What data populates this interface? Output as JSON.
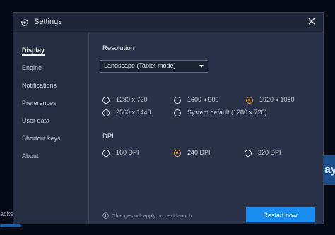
{
  "window": {
    "title": "Settings",
    "icons": {
      "app": "gear-icon",
      "close": "close-icon"
    }
  },
  "sidebar": {
    "items": [
      {
        "label": "Display",
        "active": true
      },
      {
        "label": "Engine"
      },
      {
        "label": "Notifications"
      },
      {
        "label": "Preferences"
      },
      {
        "label": "User data"
      },
      {
        "label": "Shortcut keys"
      },
      {
        "label": "About"
      }
    ]
  },
  "display": {
    "resolution": {
      "heading": "Resolution",
      "mode_selected": "Landscape (Tablet mode)",
      "options": [
        {
          "label": "1280 x 720",
          "checked": false
        },
        {
          "label": "1600 x 900",
          "checked": false
        },
        {
          "label": "1920 x 1080",
          "checked": true
        },
        {
          "label": "2560 x 1440",
          "checked": false
        },
        {
          "label": "System default (1280 x 720)",
          "checked": false
        }
      ]
    },
    "dpi": {
      "heading": "DPI",
      "options": [
        {
          "label": "160 DPI",
          "checked": false
        },
        {
          "label": "240 DPI",
          "checked": true
        },
        {
          "label": "320 DPI",
          "checked": false
        }
      ]
    },
    "footer": {
      "note": "Changes will apply on next launch",
      "restart_label": "Restart now"
    }
  },
  "background": {
    "left_text": "acks",
    "right_text": "ay"
  },
  "colors": {
    "accent": "#1a8cf0",
    "radio_selected": "#f0a030",
    "window_bg": "#2a3249",
    "titlebar_bg": "#1f263a"
  }
}
